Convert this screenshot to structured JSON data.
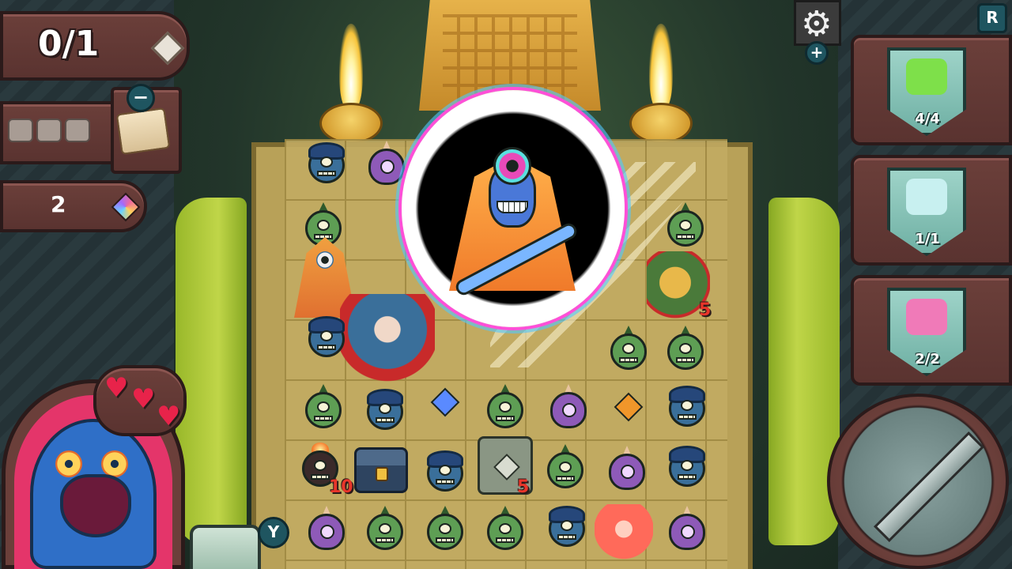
{
  "hud": {
    "stage_progress": "0/1",
    "shards_count": "2",
    "minus_label": "−",
    "plus_label": "+",
    "settings_icon": "⚙",
    "r_key_label": "R",
    "y_key_label": "Y"
  },
  "items": [
    {
      "name": "green-potion",
      "count": "4/4",
      "color": "#7ee04a"
    },
    {
      "name": "lightning-blade",
      "count": "1/1",
      "color": "#c8f0f0"
    },
    {
      "name": "pink-jar",
      "count": "2/2",
      "color": "#f07ab8"
    }
  ],
  "player": {
    "hearts": 3,
    "heart_glyph": "♥"
  },
  "damage_numbers": {
    "bomb_enemy": "10",
    "stone_enemy": "5",
    "mask_enemy": "5"
  },
  "colors": {
    "wood": "#6b3f3a",
    "board": "#c2ab62",
    "goo": "#c8de4a",
    "accent_key": "#1f5560",
    "damage": "#e8352a"
  }
}
